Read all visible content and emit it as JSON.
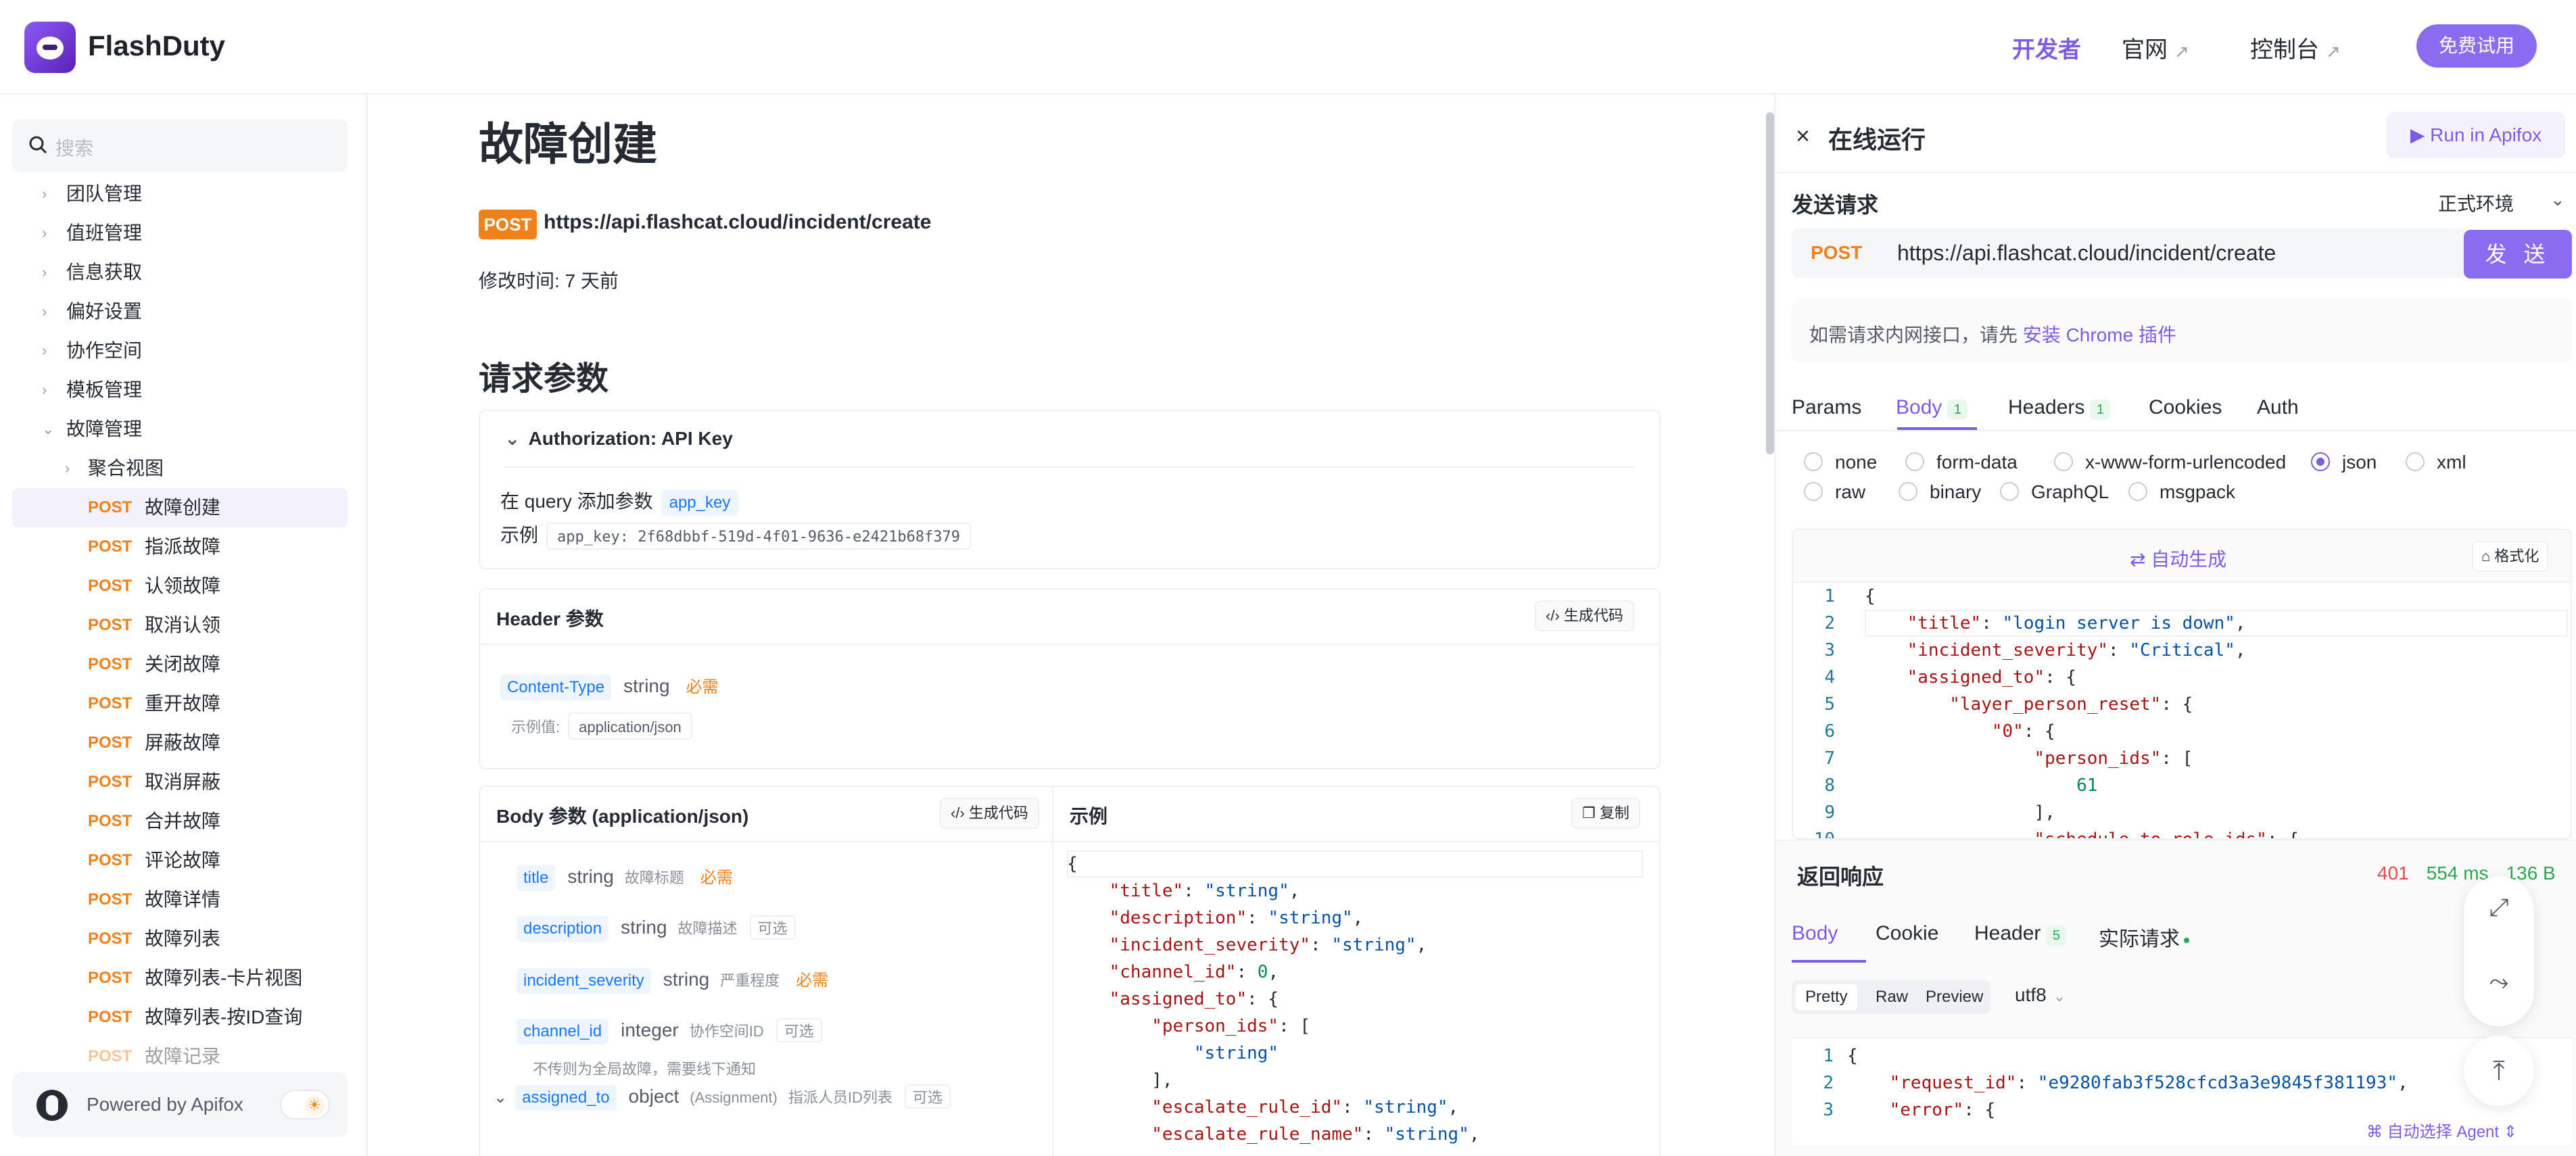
{
  "brand": {
    "name": "FlashDuty"
  },
  "topnav": {
    "developer": "开发者",
    "official_site": "官网",
    "console": "控制台",
    "arrow": "↗",
    "trial_button": "免费试用"
  },
  "sidebar": {
    "search_placeholder": "搜索",
    "folders": [
      "团队管理",
      "值班管理",
      "信息获取",
      "偏好设置",
      "协作空间",
      "模板管理",
      "故障管理"
    ],
    "subfolder": "聚合视图",
    "endpoints": [
      {
        "method": "POST",
        "label": "故障创建"
      },
      {
        "method": "POST",
        "label": "指派故障"
      },
      {
        "method": "POST",
        "label": "认领故障"
      },
      {
        "method": "POST",
        "label": "取消认领"
      },
      {
        "method": "POST",
        "label": "关闭故障"
      },
      {
        "method": "POST",
        "label": "重开故障"
      },
      {
        "method": "POST",
        "label": "屏蔽故障"
      },
      {
        "method": "POST",
        "label": "取消屏蔽"
      },
      {
        "method": "POST",
        "label": "合并故障"
      },
      {
        "method": "POST",
        "label": "评论故障"
      },
      {
        "method": "POST",
        "label": "故障详情"
      },
      {
        "method": "POST",
        "label": "故障列表"
      },
      {
        "method": "POST",
        "label": "故障列表-卡片视图"
      },
      {
        "method": "POST",
        "label": "故障列表-按ID查询"
      },
      {
        "method": "POST",
        "label": "故障记录"
      }
    ],
    "powered_by": "Powered by Apifox"
  },
  "doc": {
    "title": "故障创建",
    "method": "POST",
    "url": "https://api.flashcat.cloud/incident/create",
    "modified": "修改时间: 7 天前",
    "request_params_title": "请求参数",
    "auth": {
      "title": "Authorization: API Key",
      "query_prefix": "在 query 添加参数",
      "param": "app_key",
      "example_label": "示例",
      "example_value": "app_key: 2f68dbbf-519d-4f01-9636-e2421b68f379"
    },
    "header": {
      "title": "Header 参数",
      "gen_code": "生成代码",
      "name": "Content-Type",
      "type": "string",
      "required": "必需",
      "example_label": "示例值:",
      "example_value": "application/json"
    },
    "body": {
      "title": "Body 参数 (application/json)",
      "gen_code": "生成代码",
      "example_title": "示例",
      "copy": "复制",
      "params": [
        {
          "name": "title",
          "type": "string",
          "desc": "故障标题",
          "flag": "必需"
        },
        {
          "name": "description",
          "type": "string",
          "desc": "故障描述",
          "flag": "可选"
        },
        {
          "name": "incident_severity",
          "type": "string",
          "desc": "严重程度",
          "flag": "必需"
        },
        {
          "name": "channel_id",
          "type": "integer",
          "desc": "协作空间ID",
          "flag": "可选"
        },
        {
          "name": "assigned_to",
          "type": "object",
          "type_extra": "(Assignment)",
          "desc": "指派人员ID列表",
          "flag": "可选"
        }
      ],
      "channel_note": "不传则为全局故障，需要线下通知"
    }
  },
  "run_panel": {
    "close": "×",
    "title": "在线运行",
    "run_in_apifox": "▶ Run in Apifox",
    "send_request": "发送请求",
    "env": "正式环境",
    "method": "POST",
    "url": "https://api.flashcat.cloud/incident/create",
    "send_button": "发 送",
    "hint": "如需请求内网接口，请先",
    "hint_link": "安装 Chrome 插件",
    "tabs": [
      {
        "label": "Params"
      },
      {
        "label": "Body",
        "badge": "1"
      },
      {
        "label": "Headers",
        "badge": "1"
      },
      {
        "label": "Cookies"
      },
      {
        "label": "Auth"
      }
    ],
    "body_types": [
      "none",
      "form-data",
      "x-www-form-urlencoded",
      "json",
      "xml",
      "raw",
      "binary",
      "GraphQL",
      "msgpack"
    ],
    "selected_body_type": "json",
    "autogen": "自动生成",
    "format": "格式化",
    "response": {
      "title": "返回响应",
      "status": "401",
      "time": "554 ms",
      "size": "136 B",
      "tabs": [
        {
          "label": "Body"
        },
        {
          "label": "Cookie"
        },
        {
          "label": "Header",
          "badge": "5"
        },
        {
          "label": "实际请求"
        }
      ],
      "views": [
        "Pretty",
        "Raw",
        "Preview"
      ],
      "encoding": "utf8",
      "request_id": "e9280fab3f528cfcd3a3e9845f381193"
    },
    "agent": "自动选择 Agent"
  },
  "colors": {
    "accent": "#7c5ce0",
    "post": "#f0801a",
    "link": "#1677ff"
  }
}
